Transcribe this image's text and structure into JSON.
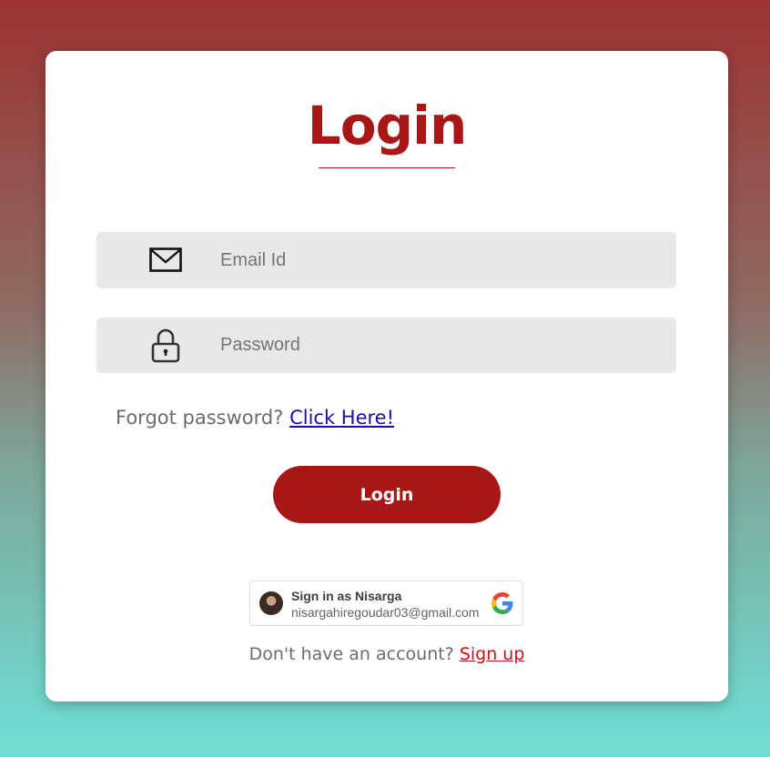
{
  "login": {
    "title": "Login",
    "email": {
      "placeholder": "Email Id",
      "icon": "envelope-icon"
    },
    "password": {
      "placeholder": "Password",
      "icon": "lock-icon"
    },
    "forgot": {
      "text": "Forgot password?",
      "link": "Click Here!"
    },
    "submit_label": "Login"
  },
  "google": {
    "name": "Sign in as Nisarga",
    "email": "nisargahiregoudar03@gmail.com"
  },
  "signup": {
    "text": "Don't have an account?",
    "link": "Sign up"
  },
  "colors": {
    "brand": "#a81616",
    "field_bg": "#e8e8e8",
    "link_blue": "#1a0dab",
    "signup_link": "#c81414"
  }
}
